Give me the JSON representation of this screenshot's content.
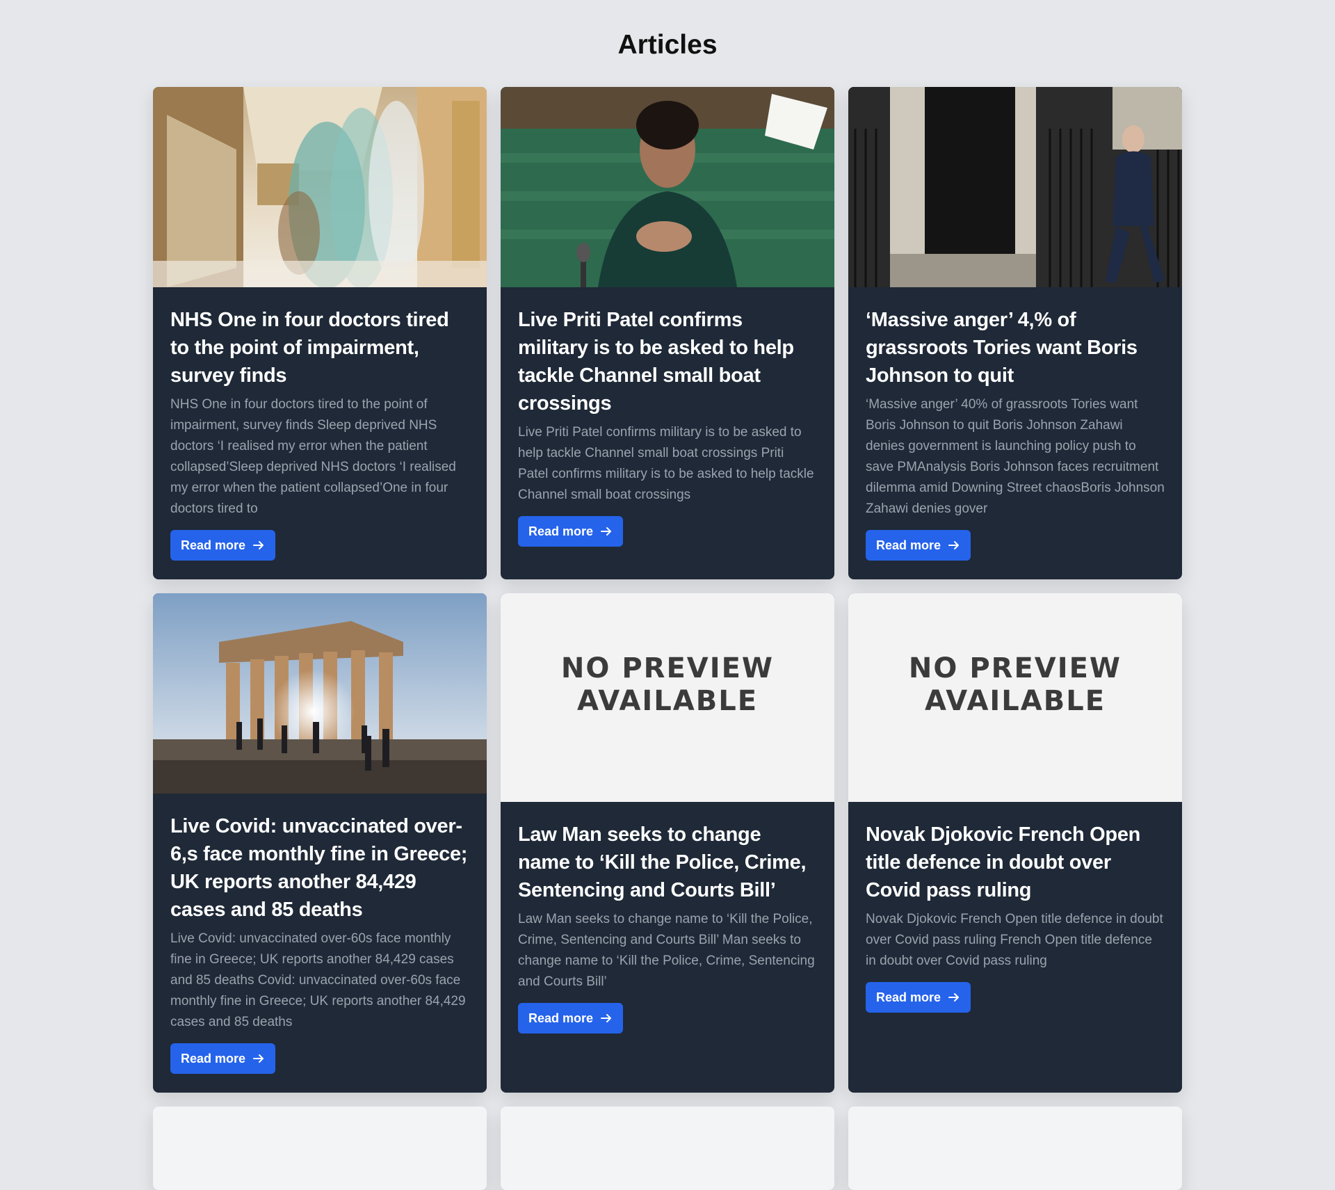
{
  "page": {
    "title": "Articles"
  },
  "cards": [
    {
      "title": "NHS One in four doctors tired to the point of impairment, survey finds",
      "description": "NHS One in four doctors tired to the point of impairment, survey finds Sleep deprived NHS doctors ‘I realised my error when the patient collapsed’Sleep deprived NHS doctors ‘I realised my error when the patient collapsed’One in four doctors tired to",
      "read_more": "Read more",
      "image": "hospital-corridor-photo"
    },
    {
      "title": "Live Priti Patel confirms military is to be asked to help tackle Channel small boat crossings",
      "description": "Live Priti Patel confirms military is to be asked to help tackle Channel small boat crossings Priti Patel confirms military is to be asked to help tackle Channel small boat crossings",
      "read_more": "Read more",
      "image": "commons-speaker-photo"
    },
    {
      "title": "‘Massive anger’ 4,% of grassroots Tories want Boris Johnson to quit",
      "description": "‘Massive anger’ 40% of grassroots Tories want Boris Johnson to quit Boris Johnson Zahawi denies government is launching policy push to save PMAnalysis Boris Johnson faces recruitment dilemma amid Downing Street chaosBoris Johnson Zahawi denies gover",
      "read_more": "Read more",
      "image": "downing-street-photo"
    },
    {
      "title": "Live Covid: unvaccinated over-6,s face monthly fine in Greece; UK reports another 84,429 cases and 85 deaths",
      "description": "Live Covid: unvaccinated over-60s face monthly fine in Greece; UK reports another 84,429 cases and 85 deaths Covid: unvaccinated over-60s face monthly fine in Greece; UK reports another 84,429 cases and 85 deaths",
      "read_more": "Read more",
      "image": "acropolis-photo"
    },
    {
      "title": "Law Man seeks to change name to ‘Kill the Police, Crime, Sentencing and Courts Bill’",
      "description": "Law Man seeks to change name to ‘Kill the Police, Crime, Sentencing and Courts Bill’ Man seeks to change name to ‘Kill the Police, Crime, Sentencing and Courts Bill’",
      "read_more": "Read more",
      "no_preview_line1": "NO PREVIEW",
      "no_preview_line2": "AVAILABLE"
    },
    {
      "title": "Novak Djokovic French Open title defence in doubt over Covid pass ruling",
      "description": "Novak Djokovic French Open title defence in doubt over Covid pass ruling French Open title defence in doubt over Covid pass ruling",
      "read_more": "Read more",
      "no_preview_line1": "NO PREVIEW",
      "no_preview_line2": "AVAILABLE"
    }
  ],
  "colors": {
    "background": "#e5e7eb",
    "card": "#1f2937",
    "accent": "#2563eb",
    "description": "#9ca3af"
  },
  "icons": {
    "read_more_icon": "arrow-right-icon"
  }
}
